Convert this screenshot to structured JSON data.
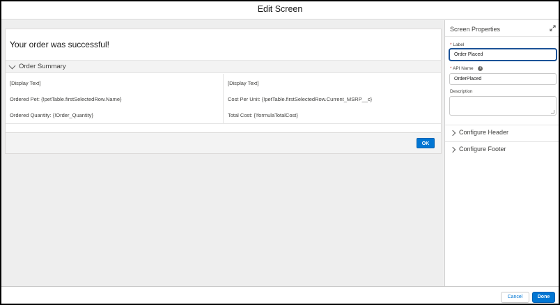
{
  "header": {
    "title": "Edit Screen"
  },
  "screen": {
    "message": "Your order was successful!",
    "section": {
      "label": "Order Summary"
    },
    "left_column": [
      "[Display Text]",
      "Ordered Pet: {!petTable.firstSelectedRow.Name}",
      "Ordered Quantity: {!Order_Quantity}"
    ],
    "right_column": [
      "[Display Text]",
      "Cost Per Unit: {!petTable.firstSelectedRow.Current_MSRP__c}",
      "Total Cost: {!formulaTotalCost}"
    ],
    "ok_label": "OK"
  },
  "properties": {
    "title": "Screen Properties",
    "label_field": {
      "label": "Label",
      "required_mark": "*",
      "value": "Order Placed"
    },
    "api_name_field": {
      "label": "API Name",
      "required_mark": "*",
      "value": "OrderPlaced"
    },
    "description_field": {
      "label": "Description",
      "value": ""
    },
    "sections": [
      "Configure Header",
      "Configure Footer"
    ]
  },
  "footer": {
    "cancel_label": "Cancel",
    "done_label": "Done"
  },
  "colors": {
    "brand": "#0176d3",
    "canvas_bg": "#eeeeee",
    "required": "#c23934",
    "focus": "#1b5297"
  },
  "icons": [
    "chevron-down-icon",
    "chevron-right-icon",
    "expand-icon",
    "info-icon",
    "resize-grip-icon"
  ]
}
